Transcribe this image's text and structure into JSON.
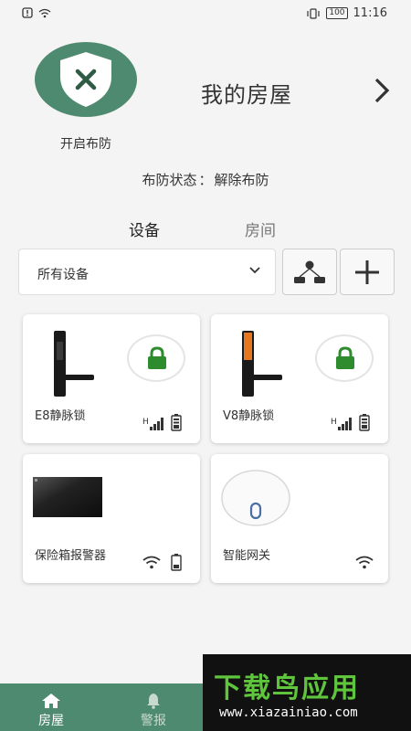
{
  "status_bar": {
    "time": "11:16",
    "battery": "100"
  },
  "header": {
    "arm_label": "开启布防",
    "house_title": "我的房屋"
  },
  "arm_status": {
    "label": "布防状态",
    "value": "解除布防"
  },
  "tabs": [
    {
      "label": "设备",
      "active": true
    },
    {
      "label": "房间",
      "active": false
    }
  ],
  "filter": {
    "selected": "所有设备"
  },
  "devices": [
    {
      "name": "E8静脉锁",
      "icons": [
        "lock-icon",
        "signal-icon",
        "battery-icon"
      ]
    },
    {
      "name": "V8静脉锁",
      "icons": [
        "lock-icon",
        "signal-icon",
        "battery-icon"
      ]
    },
    {
      "name": "保险箱报警器",
      "icons": [
        "wifi-icon",
        "battery-icon"
      ]
    },
    {
      "name": "智能网关",
      "icons": [
        "wifi-icon"
      ]
    }
  ],
  "bottom_nav": [
    {
      "label": "房屋",
      "icon": "home-icon",
      "active": true
    },
    {
      "label": "警报",
      "icon": "bell-icon",
      "active": false
    }
  ],
  "watermark": {
    "brand": "下载鸟应用",
    "url": "www.xiazainiao.com"
  },
  "colors": {
    "primary": "#4e8a6f",
    "lock_green": "#2e8b2e",
    "background": "#f4f4f4"
  }
}
